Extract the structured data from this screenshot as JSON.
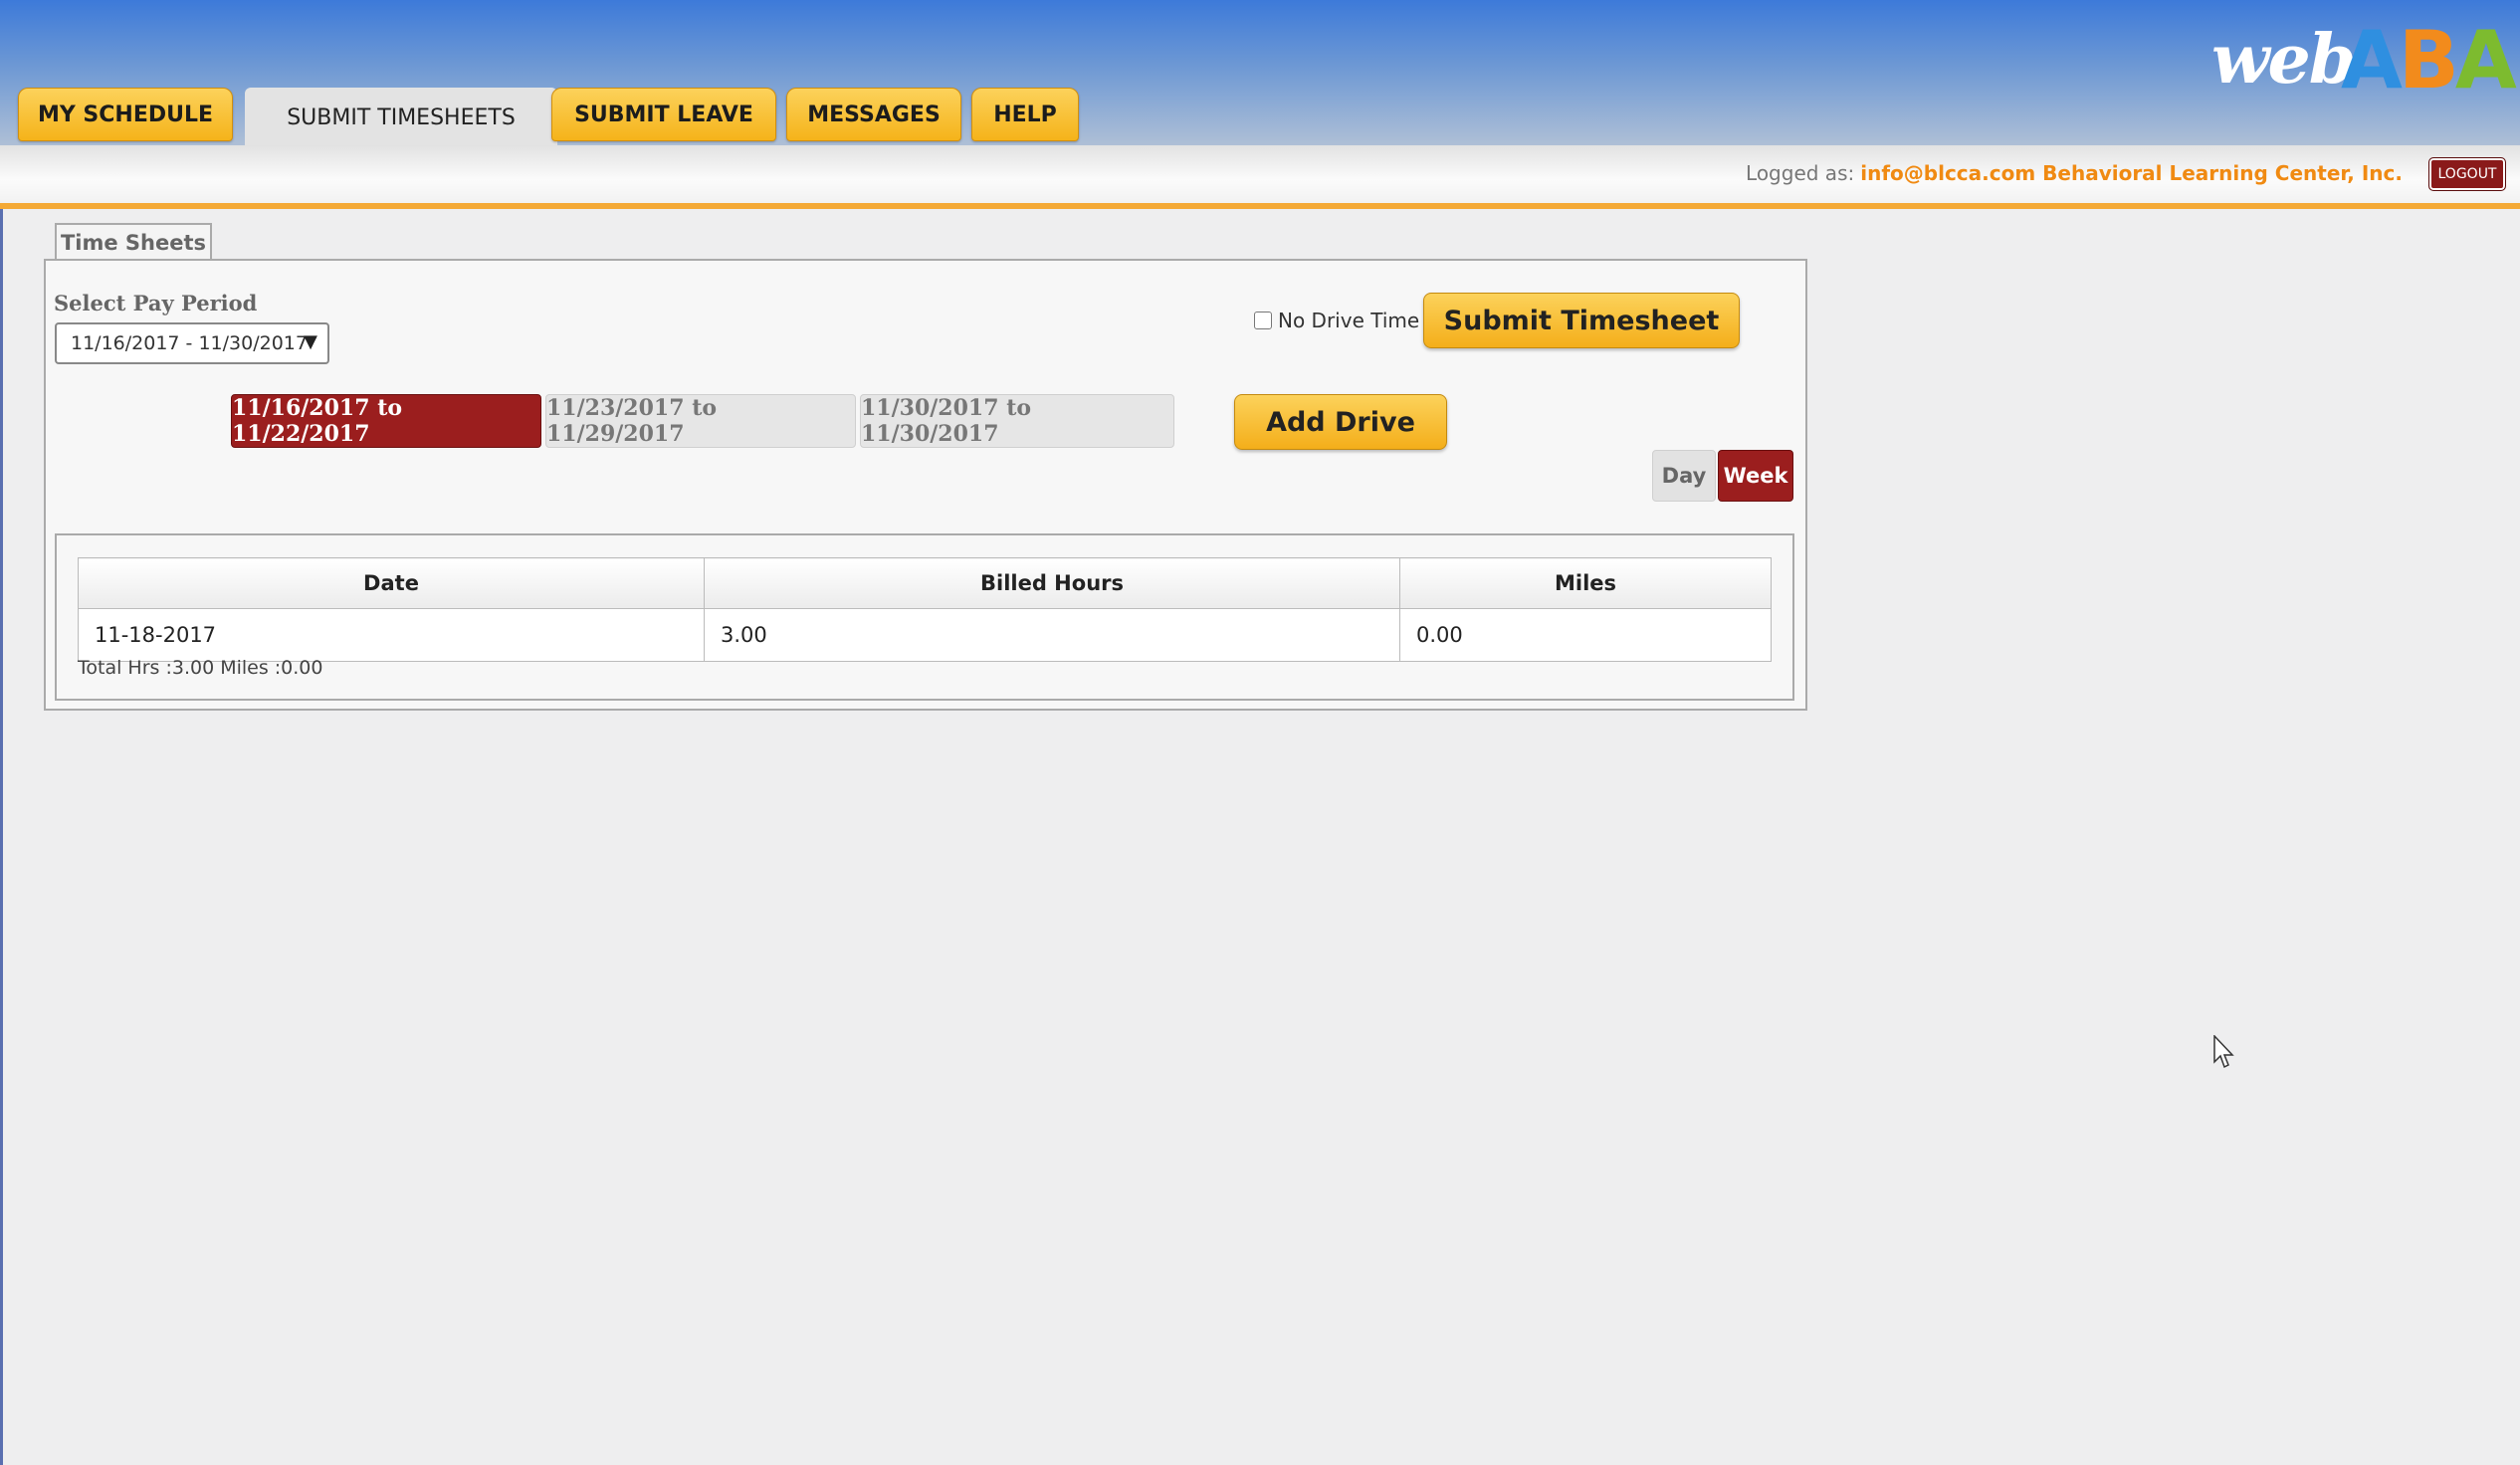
{
  "brand": {
    "logo_web": "web",
    "logo_a1": "A",
    "logo_b": "B",
    "logo_a2": "A"
  },
  "nav": {
    "tabs": [
      {
        "label": "MY SCHEDULE"
      },
      {
        "label": "SUBMIT TIMESHEETS"
      },
      {
        "label": "SUBMIT LEAVE"
      },
      {
        "label": "MESSAGES"
      },
      {
        "label": "HELP"
      }
    ],
    "active_tab": "SUBMIT TIMESHEETS"
  },
  "session": {
    "logged_label": "Logged as:",
    "user": "info@blcca.com Behavioral Learning Center, Inc.",
    "logout_label": "LOGOUT"
  },
  "timesheets": {
    "panel_tab": "Time Sheets",
    "pay_period_label": "Select Pay Period",
    "pay_period_value": "11/16/2017 - 11/30/2017",
    "no_drive_time_label": "No Drive Time",
    "no_drive_time_checked": false,
    "submit_label": "Submit Timesheet",
    "add_drive_label": "Add Drive",
    "weeks": [
      {
        "label": "11/16/2017 to 11/22/2017",
        "selected": true
      },
      {
        "label": "11/23/2017 to 11/29/2017",
        "selected": false
      },
      {
        "label": "11/30/2017 to 11/30/2017",
        "selected": false
      }
    ],
    "view_toggle": {
      "day": "Day",
      "week": "Week",
      "selected": "Week"
    },
    "table": {
      "headers": [
        "Date",
        "Billed Hours",
        "Miles"
      ],
      "rows": [
        [
          "11-18-2017",
          "3.00",
          "0.00"
        ]
      ]
    },
    "totals": "Total Hrs :3.00 Miles :0.00"
  },
  "colors": {
    "accent_red": "#9b1e1e",
    "button_yellow": "#f5b31a",
    "brand_orange": "#f08a12",
    "header_blue": "#3d7ad9"
  }
}
